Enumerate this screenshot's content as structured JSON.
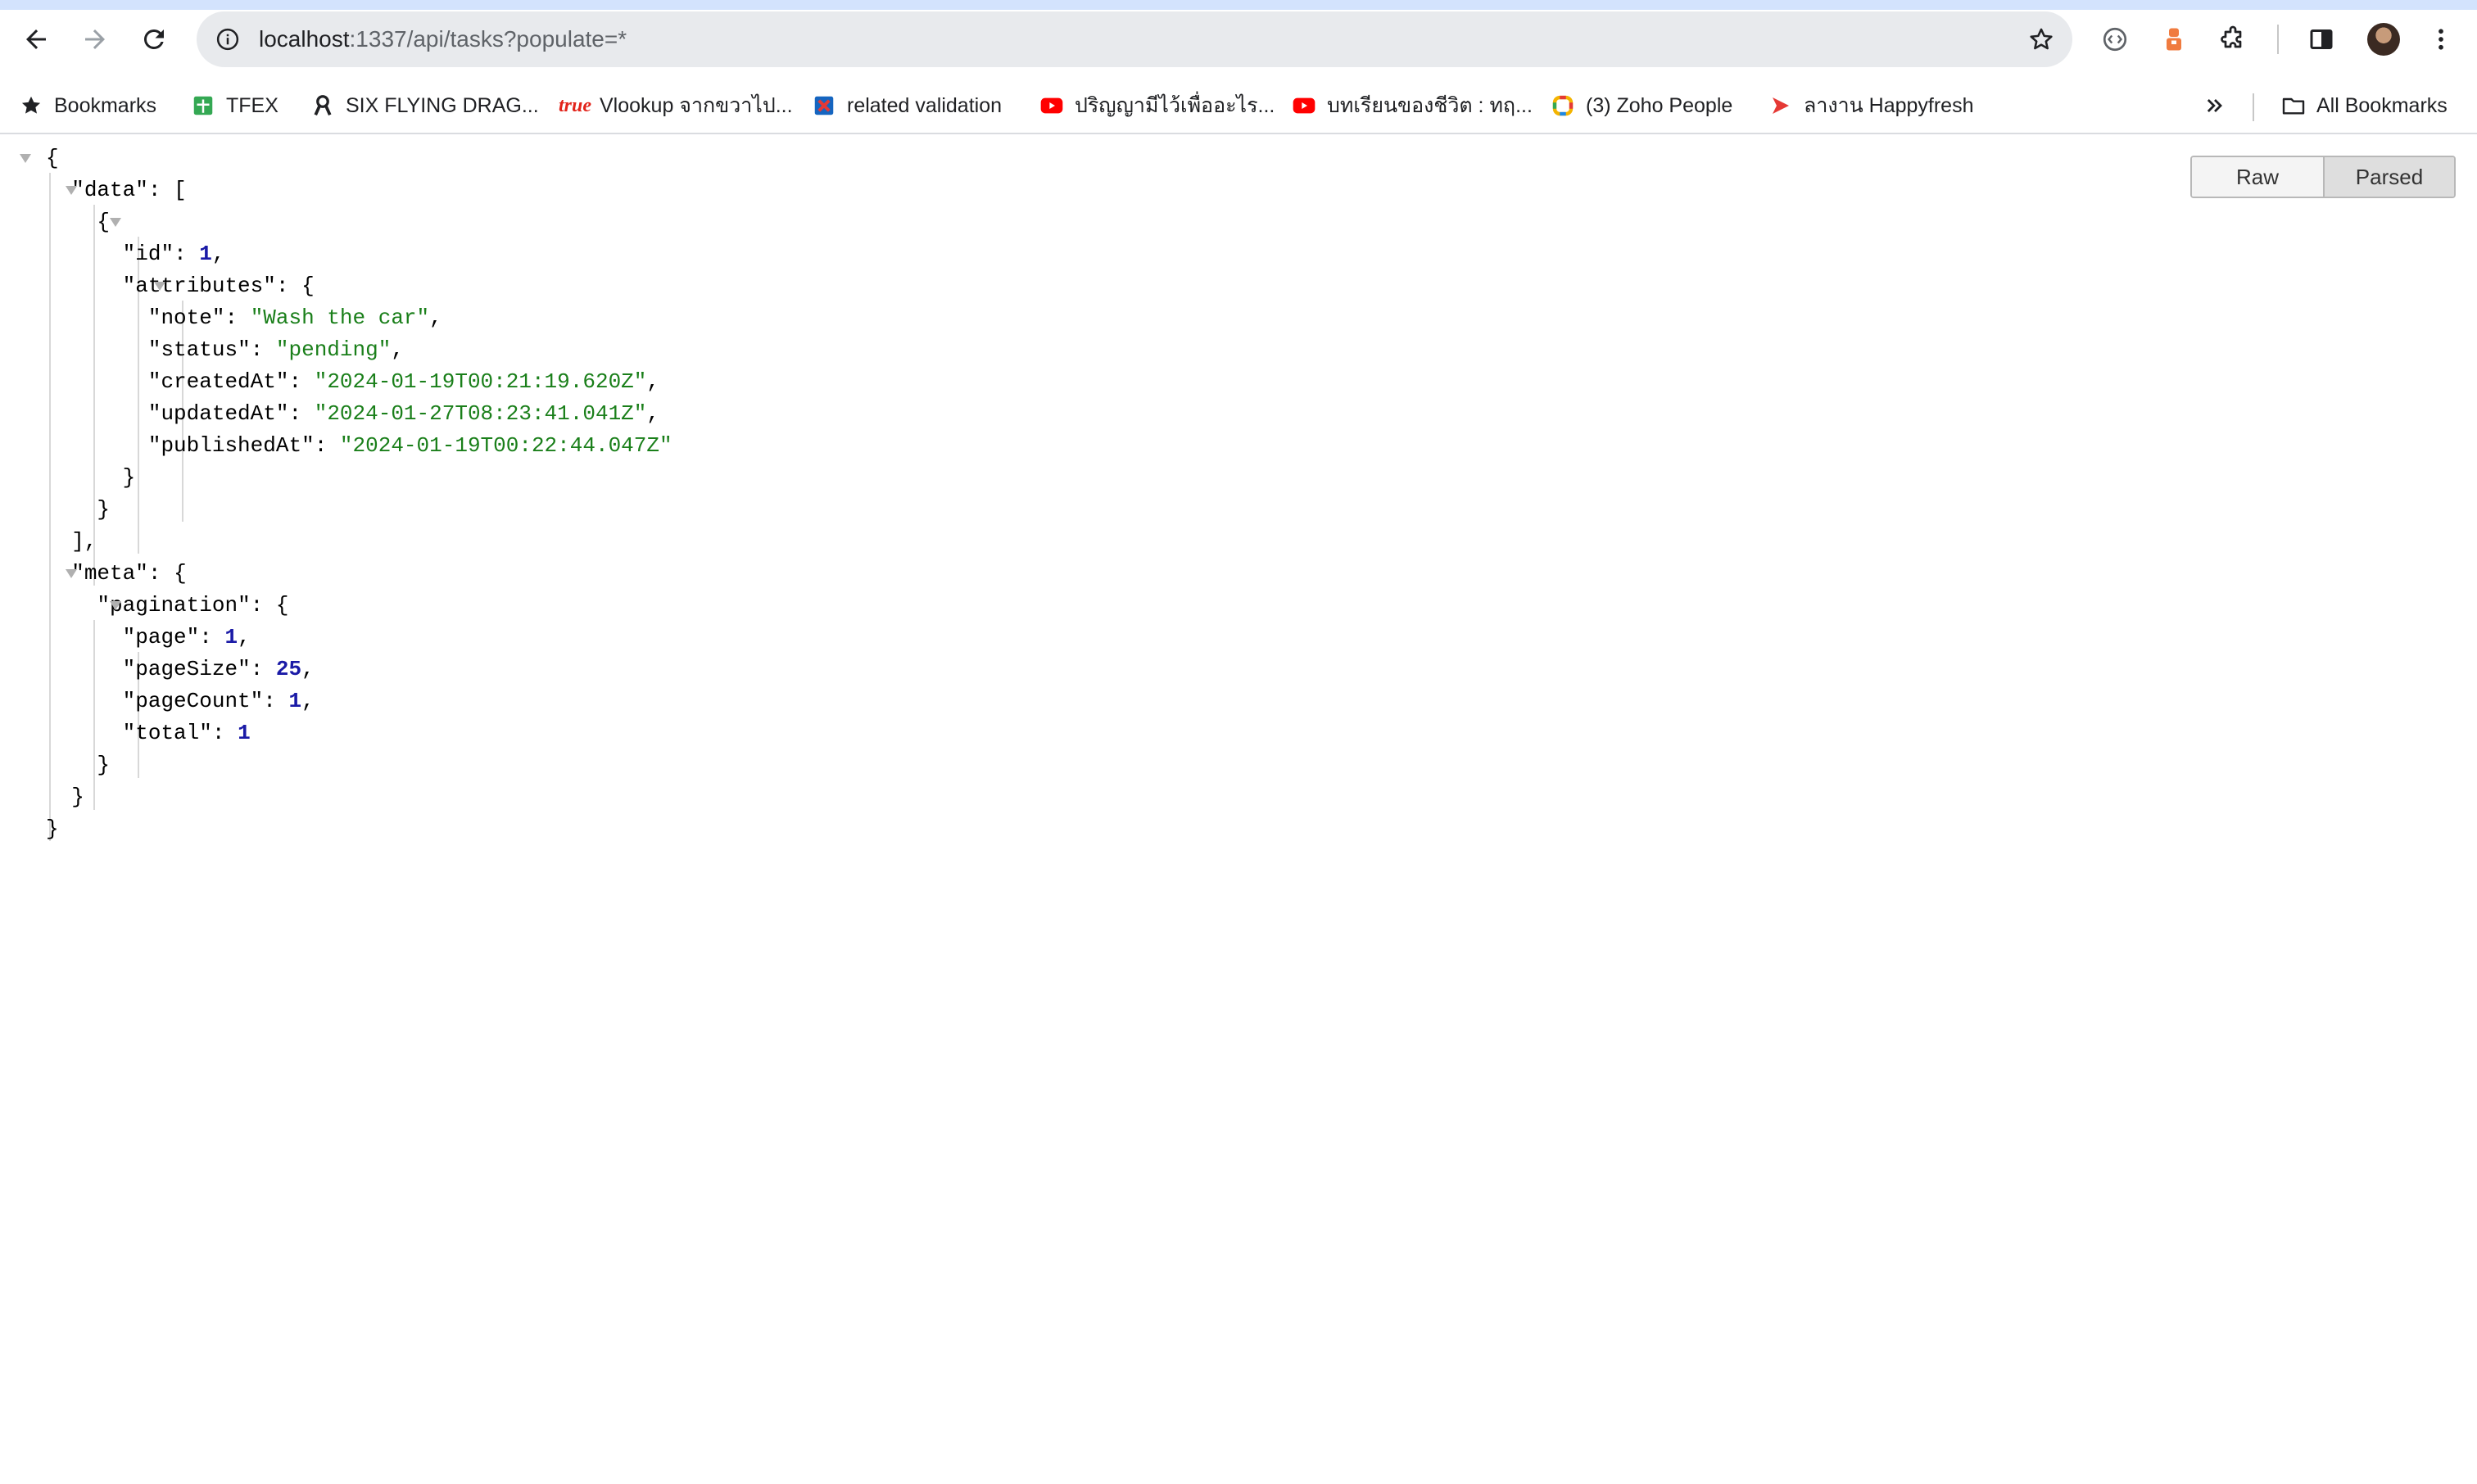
{
  "browser": {
    "url_host": "localhost",
    "url_rest": ":1337/api/tasks?populate=*",
    "buttons": [
      "back-icon",
      "forward-icon",
      "reload-icon",
      "bookmark-star-icon",
      "extension-icon",
      "side-panel-icon",
      "menu-icon"
    ]
  },
  "bookmarks": {
    "items": [
      {
        "label": "Bookmarks",
        "icon": "star-icon"
      },
      {
        "label": "TFEX",
        "icon": "sheets-icon"
      },
      {
        "label": "SIX FLYING DRAG...",
        "icon": "ribbon-icon"
      },
      {
        "label": "Vlookup จากขวาไป...",
        "icon": "true-logo-icon"
      },
      {
        "label": "related validation",
        "icon": "puzzle-logo-icon"
      },
      {
        "label": "ปริญญามีไว้เพื่ออะไร...",
        "icon": "youtube-icon"
      },
      {
        "label": "บทเรียนของชีวิต : ทฤ...",
        "icon": "youtube-icon"
      },
      {
        "label": "(3) Zoho People",
        "icon": "zoho-icon"
      },
      {
        "label": "ลางาน Happyfresh",
        "icon": "happyfresh-icon"
      }
    ],
    "all_label": "All Bookmarks"
  },
  "viewer": {
    "raw_label": "Raw",
    "parsed_label": "Parsed",
    "active_view": "Parsed"
  },
  "json": {
    "data_key": "data",
    "id_key": "id",
    "id_value": "1",
    "attributes_key": "attributes",
    "note_key": "note",
    "note_value": "Wash the car",
    "status_key": "status",
    "status_value": "pending",
    "createdAt_key": "createdAt",
    "createdAt_value": "2024-01-19T00:21:19.620Z",
    "updatedAt_key": "updatedAt",
    "updatedAt_value": "2024-01-27T08:23:41.041Z",
    "publishedAt_key": "publishedAt",
    "publishedAt_value": "2024-01-19T00:22:44.047Z",
    "meta_key": "meta",
    "pagination_key": "pagination",
    "page_key": "page",
    "page_value": "1",
    "pageSize_key": "pageSize",
    "pageSize_value": "25",
    "pageCount_key": "pageCount",
    "pageCount_value": "1",
    "total_key": "total",
    "total_value": "1"
  }
}
